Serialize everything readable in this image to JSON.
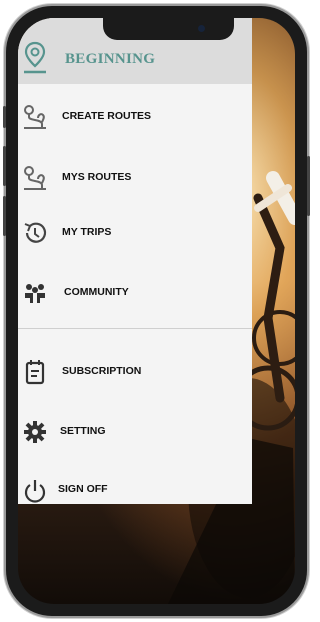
{
  "drawer": {
    "title": "BEGINNING",
    "title_color": "#57948e",
    "header_icon": "map-pin-icon",
    "items": [
      {
        "label": "CREATE ROUTES",
        "icon": "route-icon"
      },
      {
        "label": "MYS ROUTES",
        "icon": "route-icon"
      },
      {
        "label": "MY TRIPS",
        "icon": "history-icon"
      },
      {
        "label": "COMMUNITY",
        "icon": "community-icon"
      },
      {
        "label": "SUBSCRIPTION",
        "icon": "calendar-icon"
      },
      {
        "label": "SETTING",
        "icon": "gear-icon"
      },
      {
        "label": "SIGN OFF",
        "icon": "power-icon"
      }
    ]
  }
}
